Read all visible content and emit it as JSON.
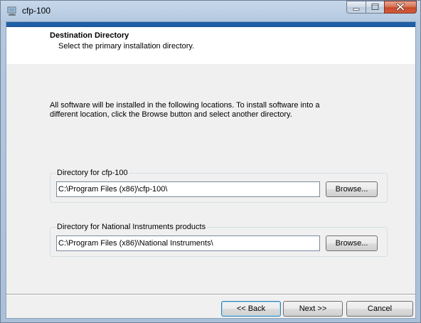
{
  "window": {
    "title": "cfp-100"
  },
  "header": {
    "title": "Destination Directory",
    "subtitle": "Select the primary installation directory."
  },
  "intro_text": "All software will be installed in the following locations. To install software into a\ndifferent location, click the Browse button and select another directory.",
  "groups": [
    {
      "label": "Directory for cfp-100",
      "path": "C:\\Program Files (x86)\\cfp-100\\",
      "browse_label": "Browse..."
    },
    {
      "label": "Directory for National Instruments products",
      "path": "C:\\Program Files (x86)\\National Instruments\\",
      "browse_label": "Browse..."
    }
  ],
  "footer": {
    "back_label": "<< Back",
    "next_label": "Next >>",
    "cancel_label": "Cancel"
  },
  "colors": {
    "header_strip": "#1f5fa8",
    "client_bg": "#f0f0f0",
    "close_button": "#c74a2b"
  },
  "icons": {
    "app": "installer-icon",
    "minimize": "minimize-icon",
    "maximize": "maximize-icon",
    "close": "close-icon"
  }
}
